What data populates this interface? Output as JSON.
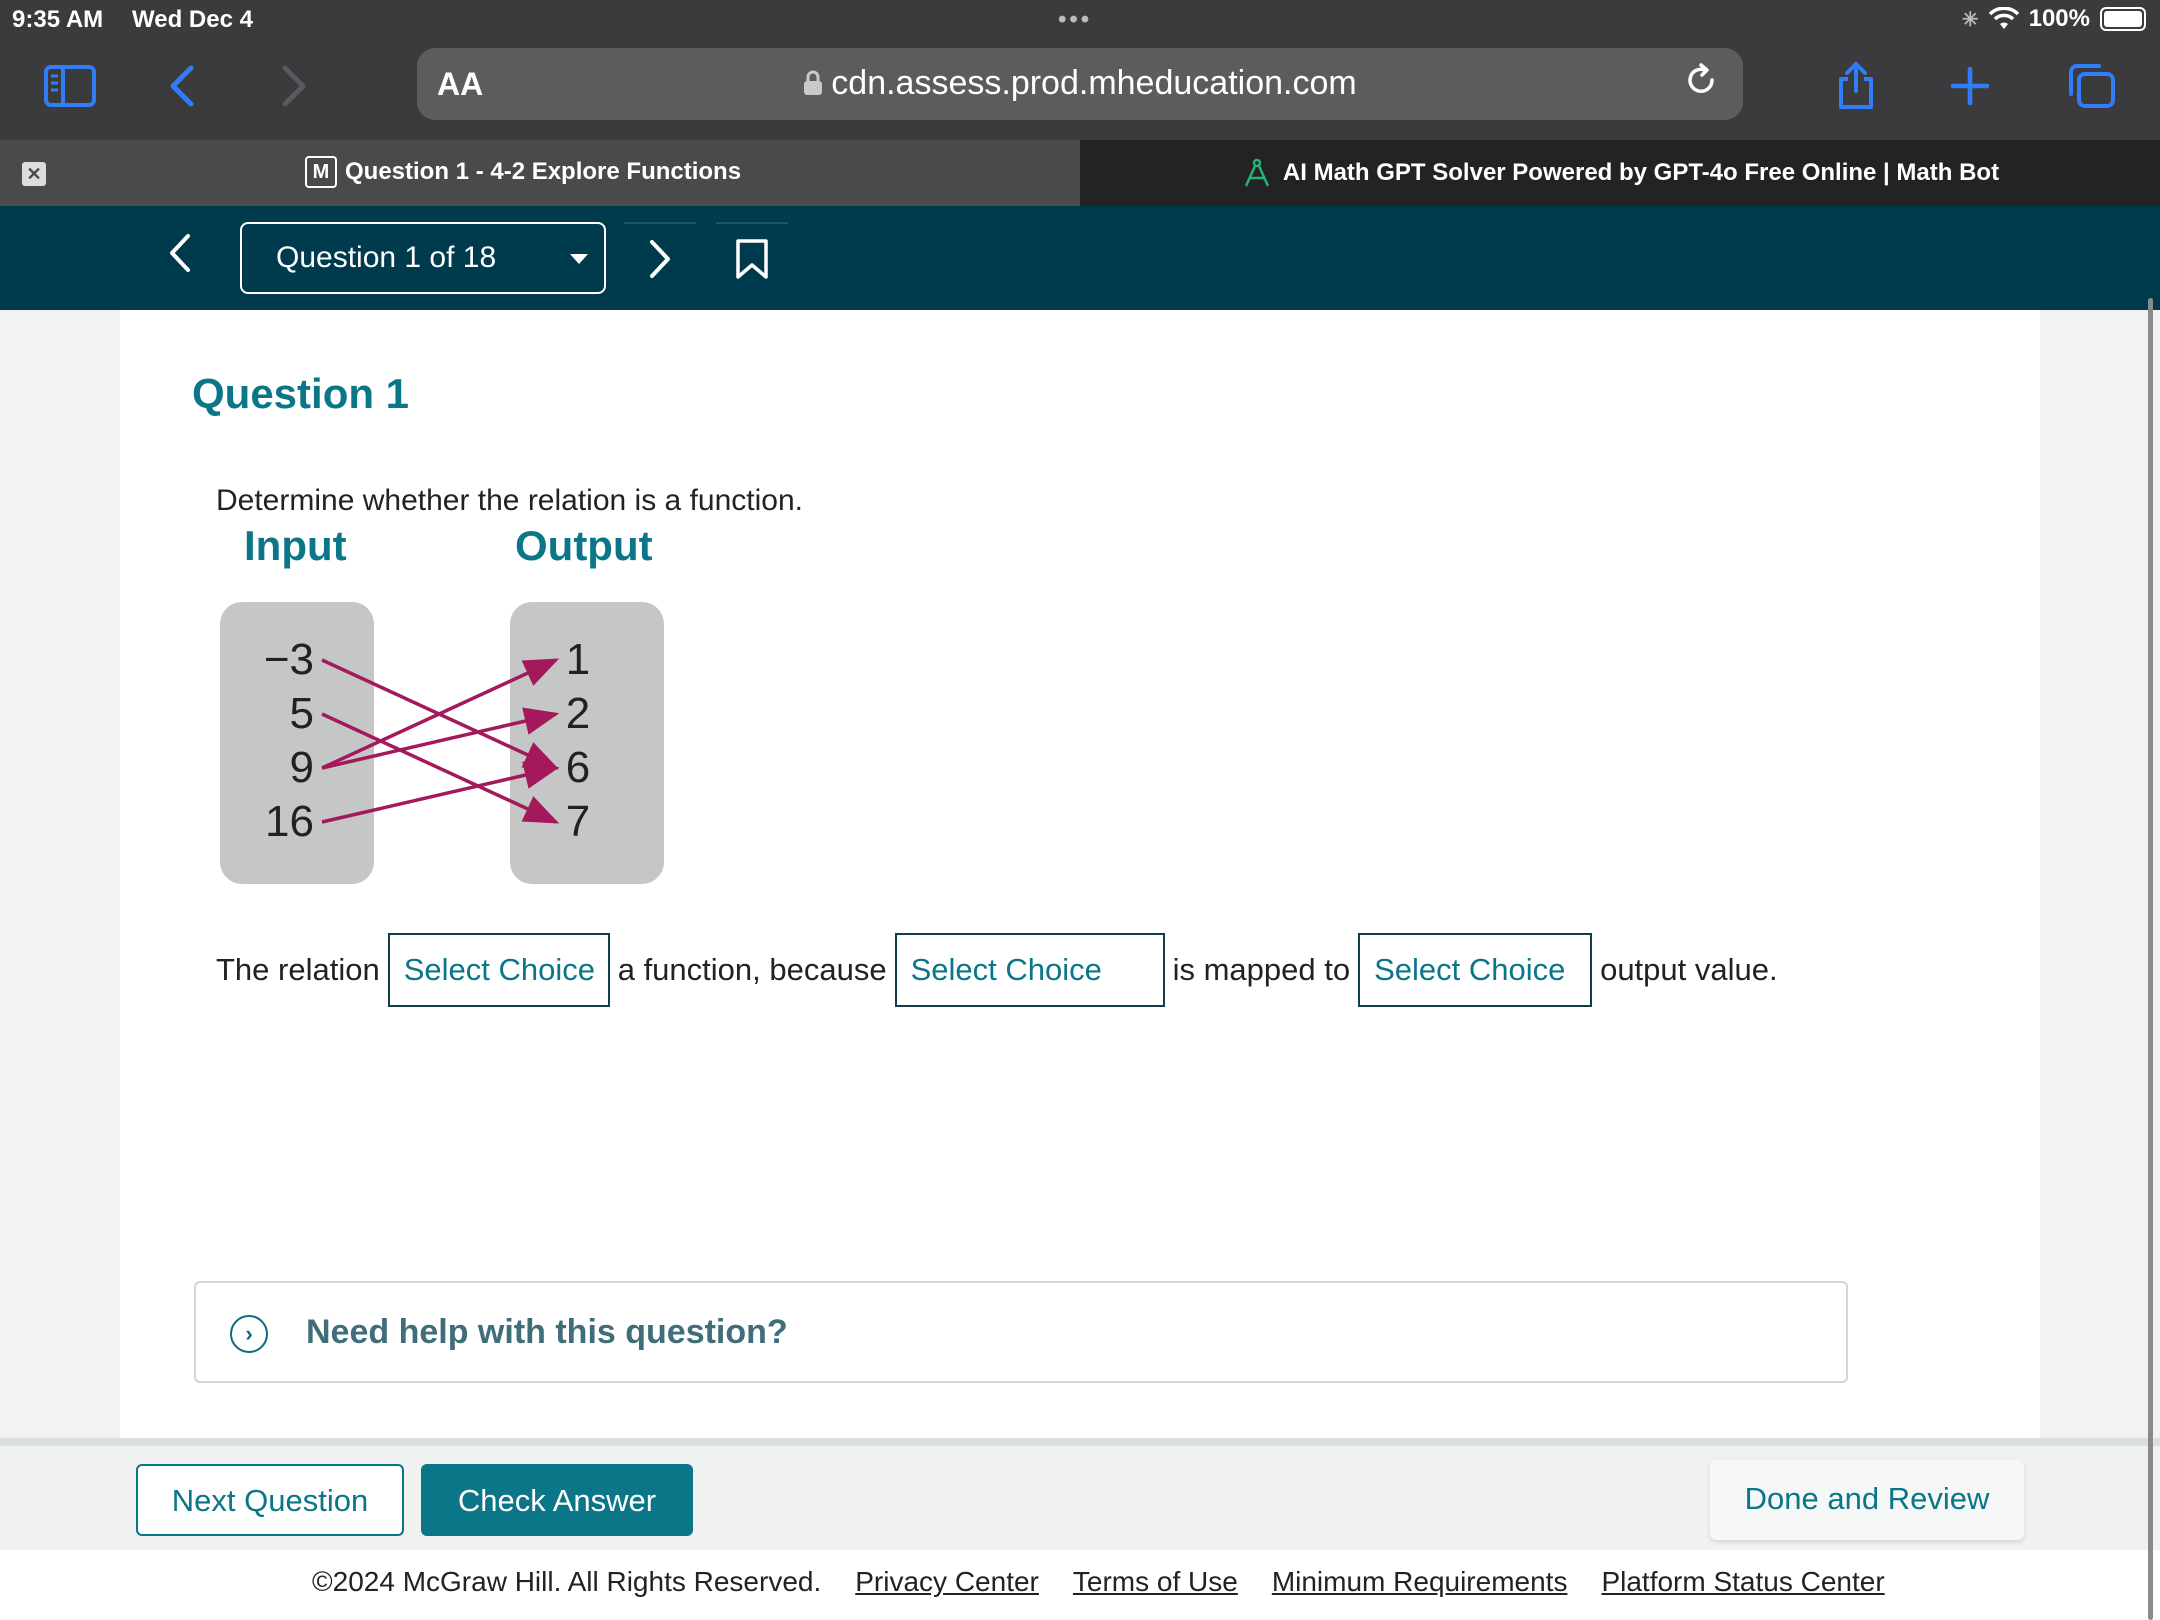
{
  "status_bar": {
    "time": "9:35 AM",
    "date": "Wed Dec 4",
    "battery": "100%"
  },
  "browser": {
    "aa_label": "AA",
    "url": "cdn.assess.prod.mheducation.com",
    "tabs": [
      {
        "title": "Question 1 - 4-2 Explore Functions",
        "logo": "M"
      },
      {
        "title": "AI Math GPT Solver Powered by GPT-4o Free Online | Math Bot"
      }
    ]
  },
  "nav": {
    "question_selector": "Question 1 of 18"
  },
  "question": {
    "title": "Question 1",
    "prompt": "Determine whether the relation is a function.",
    "mapping": {
      "input_label": "Input",
      "output_label": "Output",
      "inputs": [
        "−3",
        "5",
        "9",
        "16"
      ],
      "outputs": [
        "1",
        "2",
        "6",
        "7"
      ],
      "arrows": [
        [
          "−3",
          "6"
        ],
        [
          "5",
          "7"
        ],
        [
          "9",
          "1"
        ],
        [
          "9",
          "2"
        ],
        [
          "16",
          "6"
        ]
      ]
    },
    "answer": {
      "text_1": "The relation",
      "select_1": "Select Choice",
      "text_2": "a function, because",
      "select_2": "Select Choice",
      "text_3": "is mapped to",
      "select_3": "Select Choice",
      "text_4": "output value."
    },
    "help_text": "Need help with this question?"
  },
  "actions": {
    "next_label": "Next Question",
    "check_label": "Check Answer",
    "done_label": "Done and Review"
  },
  "footer": {
    "copyright": "©2024 McGraw Hill. All Rights Reserved.",
    "links": [
      "Privacy Center",
      "Terms of Use",
      "Minimum Requirements",
      "Platform Status Center"
    ]
  },
  "colors": {
    "accent": "#0a7688",
    "header": "#003b4d",
    "arrow": "#a3195b",
    "ios_blue": "#2f7ef7"
  }
}
